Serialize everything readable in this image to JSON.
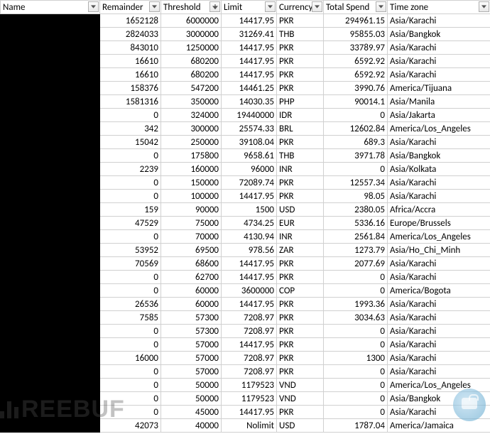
{
  "columns": [
    {
      "key": "name",
      "label": "Name",
      "css": "col-name",
      "align": "left",
      "filter": true,
      "sort": false
    },
    {
      "key": "remainder",
      "label": "Remainder",
      "css": "col-rem",
      "align": "right",
      "filter": true,
      "sort": false
    },
    {
      "key": "threshold",
      "label": "Threshold",
      "css": "col-thr",
      "align": "right",
      "filter": true,
      "sort": true
    },
    {
      "key": "limit",
      "label": "Limit",
      "css": "col-lim",
      "align": "right",
      "filter": true,
      "sort": false
    },
    {
      "key": "currency",
      "label": "Currency",
      "css": "col-cur",
      "align": "left",
      "filter": true,
      "sort": false
    },
    {
      "key": "totalspend",
      "label": "Total Spend",
      "css": "col-tot",
      "align": "right",
      "filter": true,
      "sort": false
    },
    {
      "key": "timezone",
      "label": "Time zone",
      "css": "col-tz",
      "align": "left",
      "filter": true,
      "sort": false
    }
  ],
  "rows": [
    {
      "remainder": "1652128",
      "threshold": "6000000",
      "limit": "14417.95",
      "currency": "PKR",
      "totalspend": "294961.15",
      "timezone": "Asia/Karachi"
    },
    {
      "remainder": "2824033",
      "threshold": "3000000",
      "limit": "31269.41",
      "currency": "THB",
      "totalspend": "95855.03",
      "timezone": "Asia/Bangkok"
    },
    {
      "remainder": "843010",
      "threshold": "1250000",
      "limit": "14417.95",
      "currency": "PKR",
      "totalspend": "33789.97",
      "timezone": "Asia/Karachi"
    },
    {
      "remainder": "16610",
      "threshold": "680200",
      "limit": "14417.95",
      "currency": "PKR",
      "totalspend": "6592.92",
      "timezone": "Asia/Karachi"
    },
    {
      "remainder": "16610",
      "threshold": "680200",
      "limit": "14417.95",
      "currency": "PKR",
      "totalspend": "6592.92",
      "timezone": "Asia/Karachi"
    },
    {
      "remainder": "158376",
      "threshold": "547200",
      "limit": "14461.25",
      "currency": "PKR",
      "totalspend": "3990.76",
      "timezone": "America/Tijuana"
    },
    {
      "remainder": "1581316",
      "threshold": "350000",
      "limit": "14030.35",
      "currency": "PHP",
      "totalspend": "90014.1",
      "timezone": "Asia/Manila"
    },
    {
      "remainder": "0",
      "threshold": "324000",
      "limit": "19440000",
      "currency": "IDR",
      "totalspend": "0",
      "timezone": "Asia/Jakarta"
    },
    {
      "remainder": "342",
      "threshold": "300000",
      "limit": "25574.33",
      "currency": "BRL",
      "totalspend": "12602.84",
      "timezone": "America/Los_Angeles"
    },
    {
      "remainder": "15042",
      "threshold": "250000",
      "limit": "39108.04",
      "currency": "PKR",
      "totalspend": "689.3",
      "timezone": "Asia/Karachi"
    },
    {
      "remainder": "0",
      "threshold": "175800",
      "limit": "9658.61",
      "currency": "THB",
      "totalspend": "3971.78",
      "timezone": "Asia/Bangkok"
    },
    {
      "remainder": "2239",
      "threshold": "160000",
      "limit": "96000",
      "currency": "INR",
      "totalspend": "0",
      "timezone": "Asia/Kolkata"
    },
    {
      "remainder": "0",
      "threshold": "150000",
      "limit": "72089.74",
      "currency": "PKR",
      "totalspend": "12557.34",
      "timezone": "Asia/Karachi"
    },
    {
      "remainder": "0",
      "threshold": "100000",
      "limit": "14417.95",
      "currency": "PKR",
      "totalspend": "98.05",
      "timezone": "Asia/Karachi"
    },
    {
      "remainder": "159",
      "threshold": "90000",
      "limit": "1500",
      "currency": "USD",
      "totalspend": "2380.05",
      "timezone": "Africa/Accra"
    },
    {
      "remainder": "47529",
      "threshold": "75000",
      "limit": "4734.25",
      "currency": "EUR",
      "totalspend": "5336.16",
      "timezone": "Europe/Brussels"
    },
    {
      "remainder": "0",
      "threshold": "70000",
      "limit": "4130.94",
      "currency": "INR",
      "totalspend": "2561.84",
      "timezone": "America/Los_Angeles"
    },
    {
      "remainder": "53952",
      "threshold": "69500",
      "limit": "978.56",
      "currency": "ZAR",
      "totalspend": "1273.79",
      "timezone": "Asia/Ho_Chi_Minh"
    },
    {
      "remainder": "70569",
      "threshold": "68600",
      "limit": "14417.95",
      "currency": "PKR",
      "totalspend": "2077.69",
      "timezone": "Asia/Karachi"
    },
    {
      "remainder": "0",
      "threshold": "62700",
      "limit": "14417.95",
      "currency": "PKR",
      "totalspend": "0",
      "timezone": "Asia/Karachi"
    },
    {
      "remainder": "0",
      "threshold": "60000",
      "limit": "3600000",
      "currency": "COP",
      "totalspend": "0",
      "timezone": "America/Bogota"
    },
    {
      "remainder": "26536",
      "threshold": "60000",
      "limit": "14417.95",
      "currency": "PKR",
      "totalspend": "1993.36",
      "timezone": "Asia/Karachi"
    },
    {
      "remainder": "7585",
      "threshold": "57300",
      "limit": "7208.97",
      "currency": "PKR",
      "totalspend": "3034.63",
      "timezone": "Asia/Karachi"
    },
    {
      "remainder": "0",
      "threshold": "57300",
      "limit": "7208.97",
      "currency": "PKR",
      "totalspend": "0",
      "timezone": "Asia/Karachi"
    },
    {
      "remainder": "0",
      "threshold": "57000",
      "limit": "14417.95",
      "currency": "PKR",
      "totalspend": "0",
      "timezone": "Asia/Karachi"
    },
    {
      "remainder": "16000",
      "threshold": "57000",
      "limit": "7208.97",
      "currency": "PKR",
      "totalspend": "1300",
      "timezone": "Asia/Karachi"
    },
    {
      "remainder": "0",
      "threshold": "57000",
      "limit": "7208.97",
      "currency": "PKR",
      "totalspend": "0",
      "timezone": "Asia/Karachi"
    },
    {
      "remainder": "0",
      "threshold": "50000",
      "limit": "1179523",
      "currency": "VND",
      "totalspend": "0",
      "timezone": "America/Los_Angeles"
    },
    {
      "remainder": "0",
      "threshold": "50000",
      "limit": "1179523",
      "currency": "VND",
      "totalspend": "0",
      "timezone": "Asia/Bangkok"
    },
    {
      "remainder": "0",
      "threshold": "45000",
      "limit": "14417.95",
      "currency": "PKR",
      "totalspend": "0",
      "timezone": "Asia/Karachi"
    },
    {
      "remainder": "42073",
      "threshold": "40000",
      "limit": "Nolimit",
      "currency": "USD",
      "totalspend": "1787.04",
      "timezone": "America/Jamaica"
    }
  ],
  "watermark": "REEBUF"
}
